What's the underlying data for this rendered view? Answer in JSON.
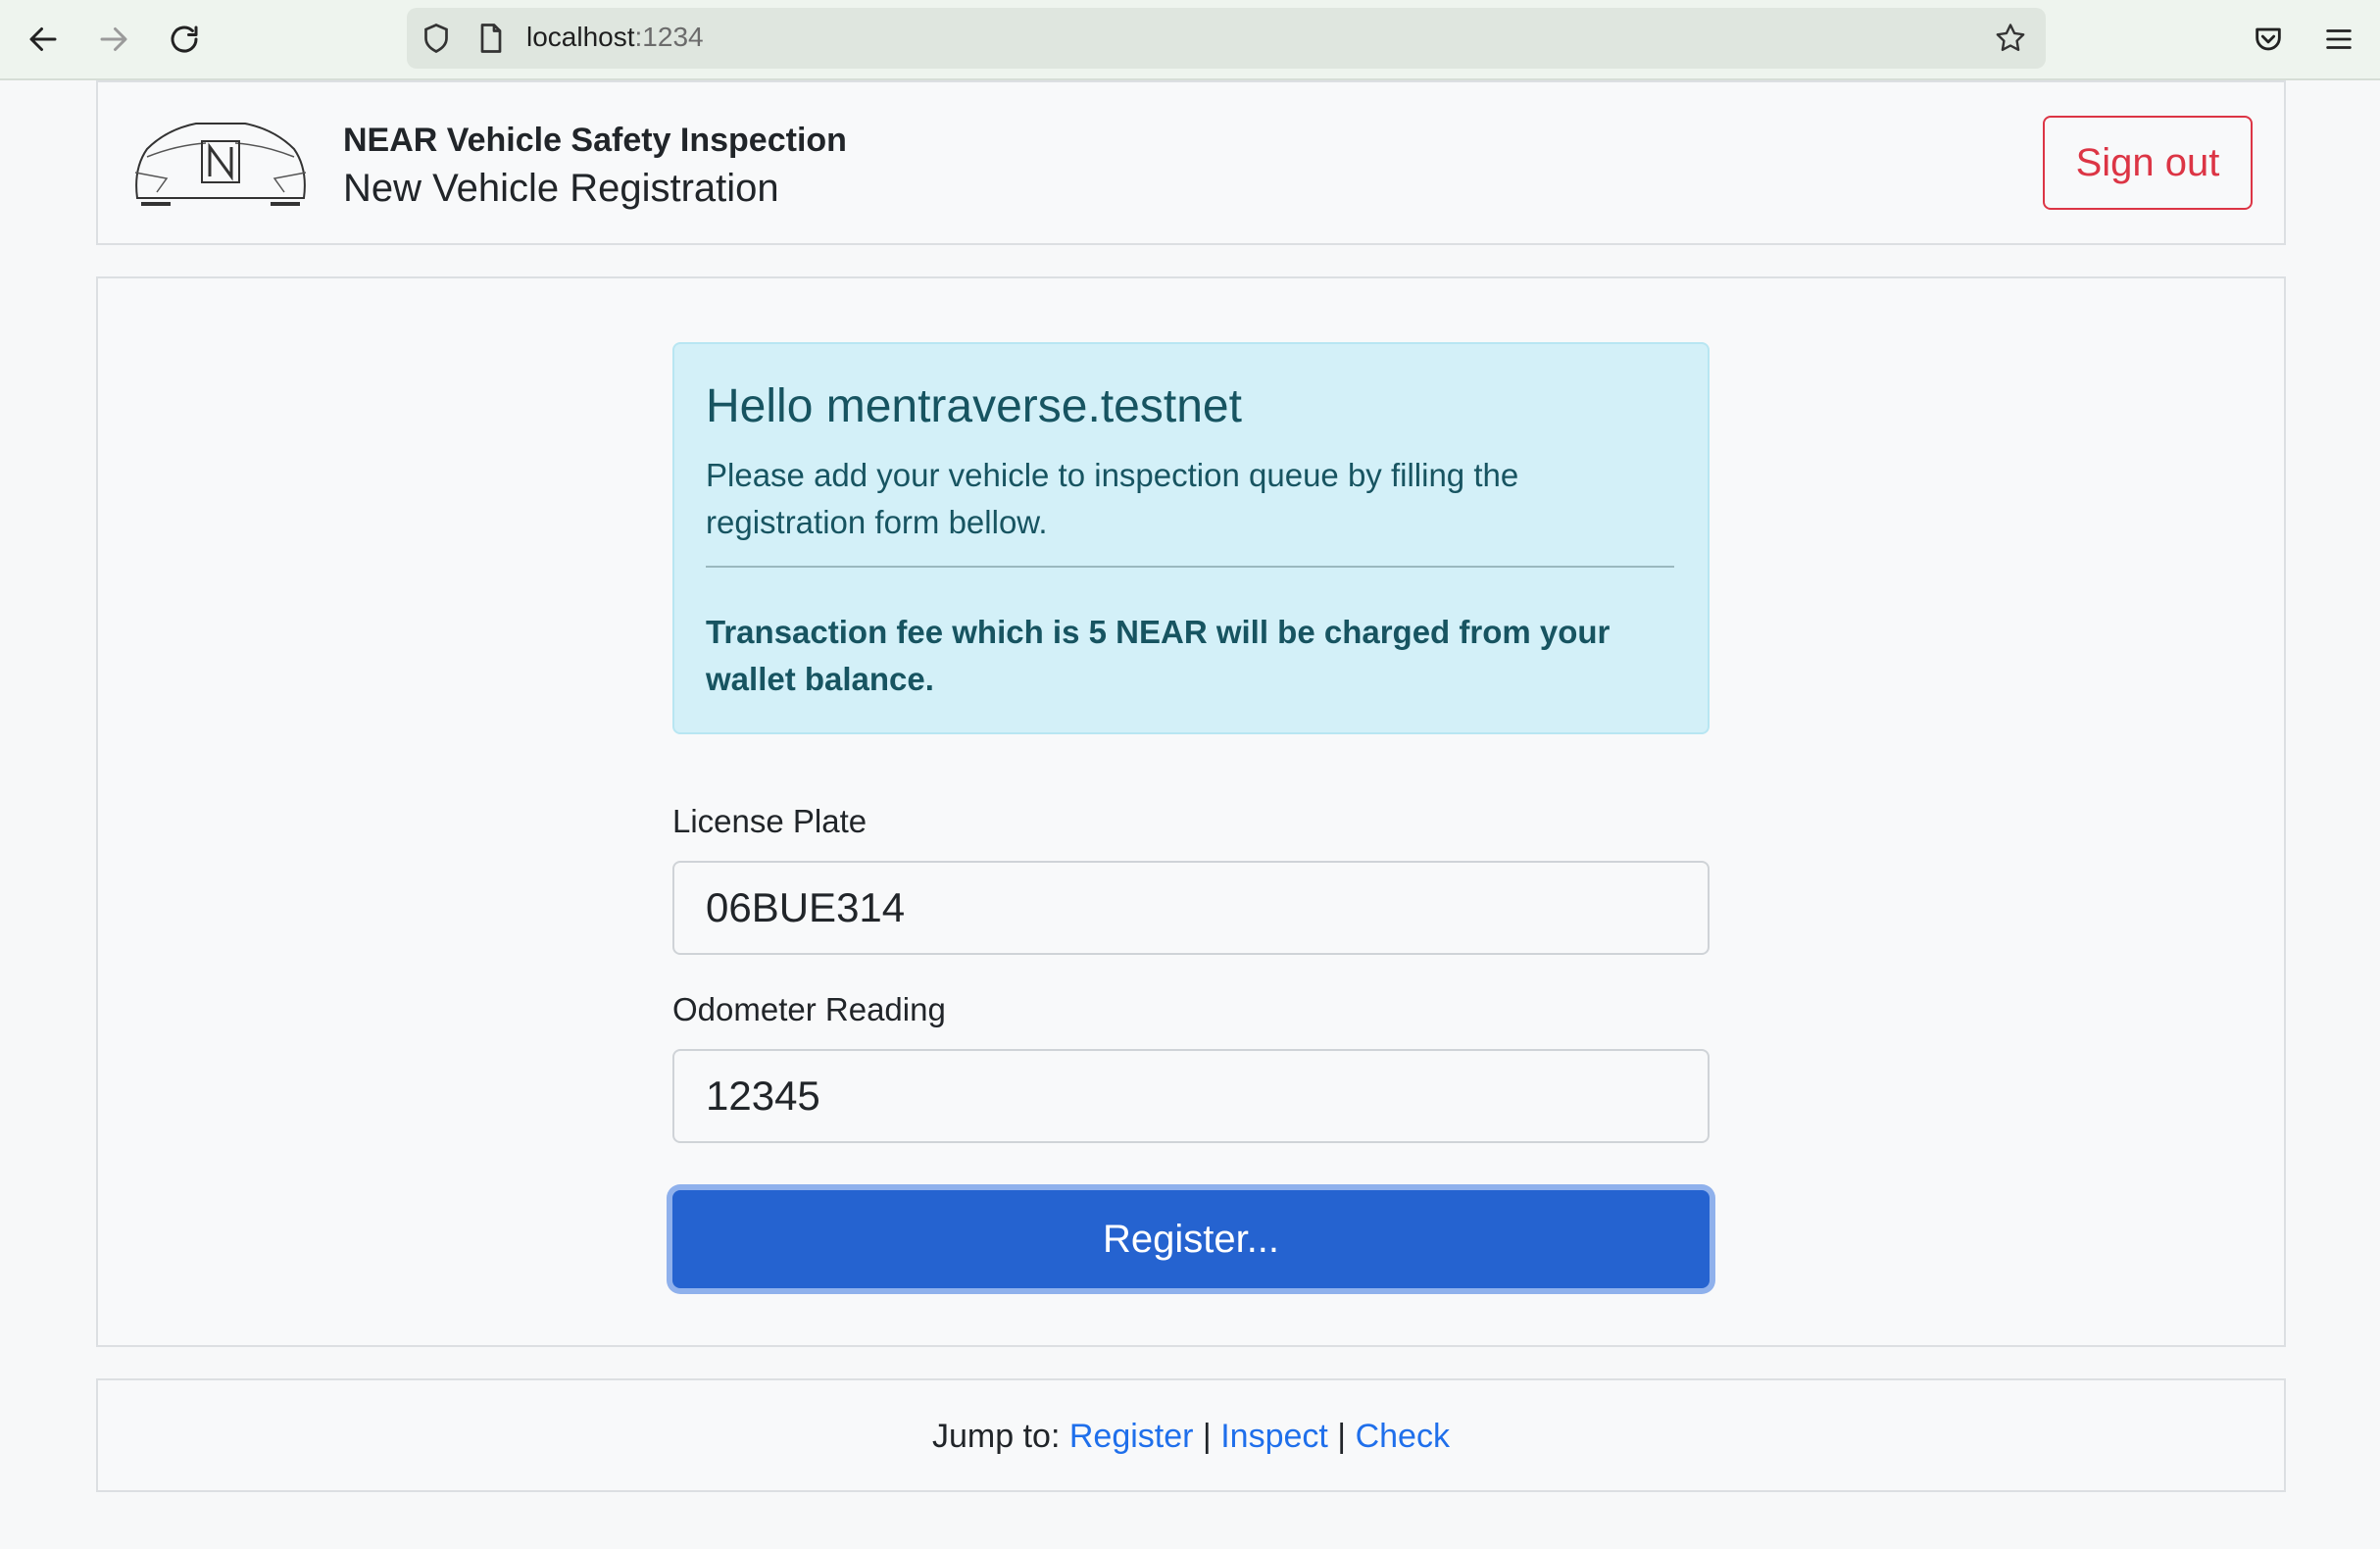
{
  "browser": {
    "url_host": "localhost",
    "url_port": ":1234"
  },
  "header": {
    "brand_title": "NEAR Vehicle Safety Inspection",
    "page_title": "New Vehicle Registration",
    "signout_label": "Sign out"
  },
  "alert": {
    "greeting": "Hello mentraverse.testnet",
    "message": "Please add your vehicle to inspection queue by filling the registration form bellow.",
    "fee_note": "Transaction fee which is 5 NEAR will be charged from your wallet balance."
  },
  "form": {
    "license_label": "License Plate",
    "license_value": "06BUE314",
    "odometer_label": "Odometer Reading",
    "odometer_value": "12345",
    "register_label": "Register..."
  },
  "footer": {
    "jump_label": "Jump to:",
    "links": [
      "Register",
      "Inspect",
      "Check"
    ],
    "separator": "|"
  },
  "colors": {
    "primary": "#2563d0",
    "danger": "#dc3545",
    "info_bg": "#d3f0f8",
    "link": "#1f6feb"
  }
}
